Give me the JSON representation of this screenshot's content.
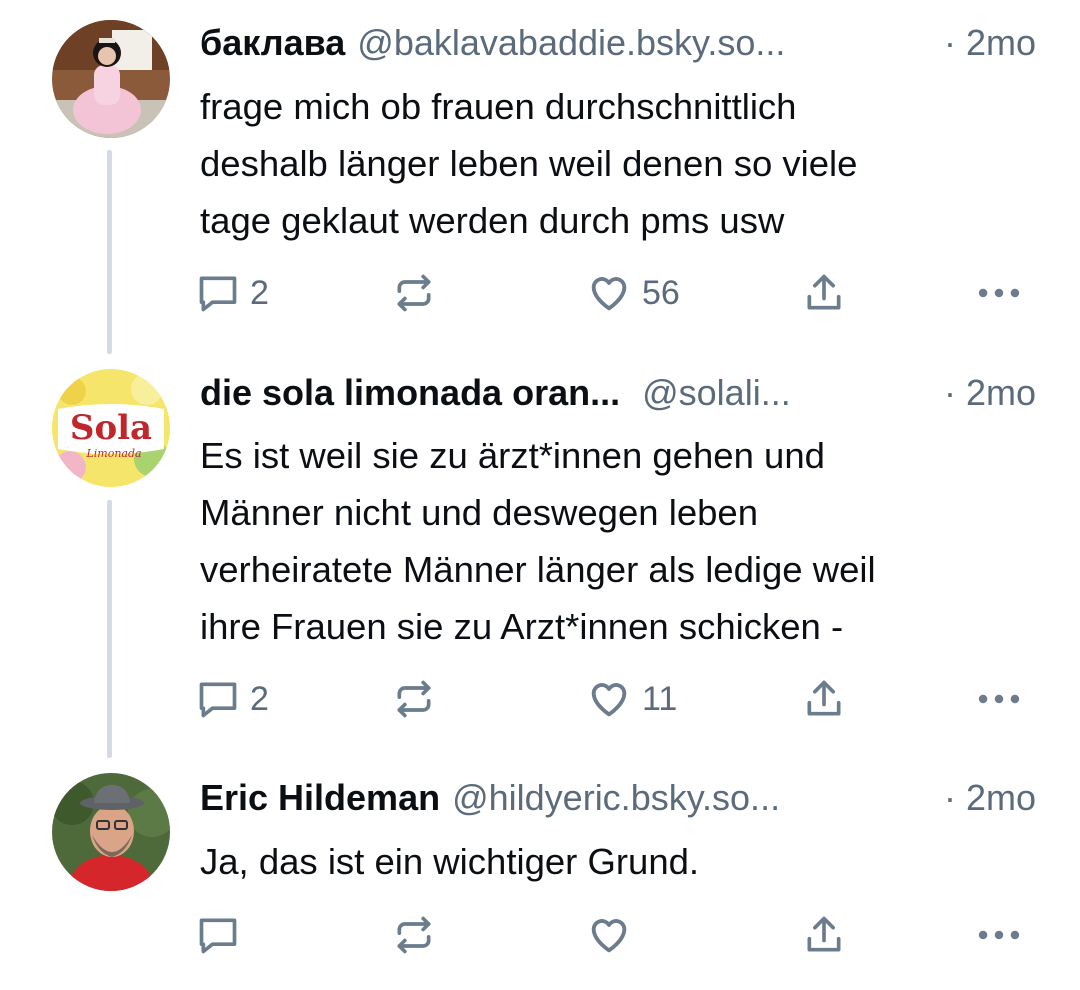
{
  "posts": [
    {
      "display_name": "баклава",
      "handle": "@baklavabaddie.bsky.so...",
      "time": "· 2mo",
      "text": "frage mich ob frauen durchschnittlich\ndeshalb länger leben weil denen so viele\ntage geklaut werden durch pms usw",
      "replies": "2",
      "reposts": "",
      "likes": "56"
    },
    {
      "display_name": "die sola limonada oran...",
      "handle": "@solali...",
      "time": "· 2mo",
      "text": "Es ist weil sie zu ärzt*innen gehen und\nMänner nicht und deswegen leben\nverheiratete Männer länger als ledige weil\nihre Frauen sie zu Arzt*innen schicken -",
      "replies": "2",
      "reposts": "",
      "likes": "11",
      "avatar_text": "Sola",
      "avatar_subtext": "Limonada"
    },
    {
      "display_name": "Eric Hildeman",
      "handle": "@hildyeric.bsky.so...",
      "time": "· 2mo",
      "text": "Ja, das ist ein wichtiger Grund.",
      "replies": "",
      "reposts": "",
      "likes": ""
    }
  ],
  "icons": {
    "reply": "reply-bubble-icon",
    "repost": "repost-arrows-icon",
    "like": "heart-icon",
    "share": "share-upload-icon",
    "more": "more-dots-icon"
  },
  "colors": {
    "text": "#0b0f14",
    "muted": "#5b6b7c",
    "icon": "#6b7c8d",
    "thread_line": "#d4dbe2"
  }
}
